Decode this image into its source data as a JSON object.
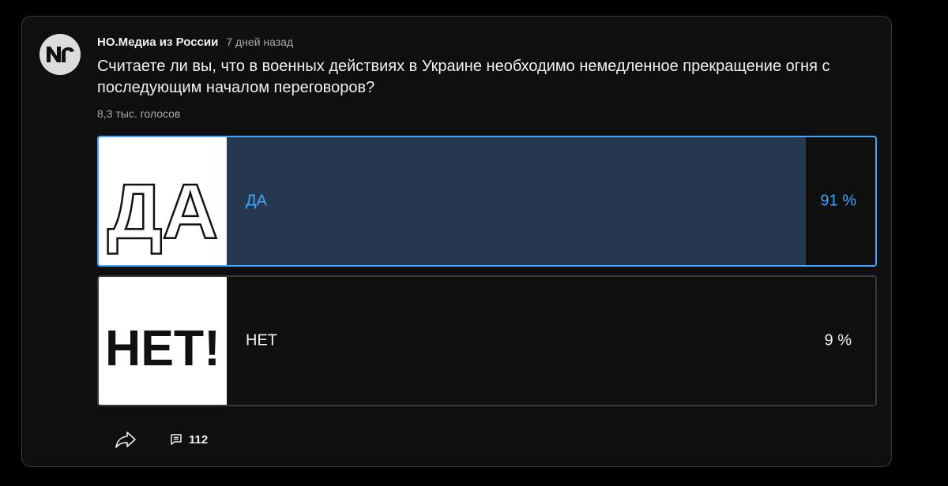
{
  "post": {
    "channel_name": "НО.Медиа из России",
    "time_ago": "7 дней назад",
    "avatar_icon": "no-media-logo",
    "question": "Считаете ли вы, что в военных действиях в Украине необходимо немедленное прекращение огня с последующим началом переговоров?",
    "votes_text": "8,3 тыс. голосов"
  },
  "poll": {
    "options": [
      {
        "label": "ДА",
        "image_text": "ДА",
        "percent_text": "91 %",
        "share": 0.91,
        "selected": true
      },
      {
        "label": "НЕТ",
        "image_text": "НЕТ!",
        "percent_text": "9 %",
        "share": 0.09,
        "selected": false
      }
    ]
  },
  "actions": {
    "share_icon": "share-icon",
    "comments_icon": "comment-icon",
    "comment_count": "112"
  },
  "colors": {
    "accent": "#3ea6ff",
    "selected_fill": "#263850",
    "unselected_fill": "#3d3d3d",
    "card_bg": "#0f0f0f",
    "border": "#3a3a3a"
  }
}
